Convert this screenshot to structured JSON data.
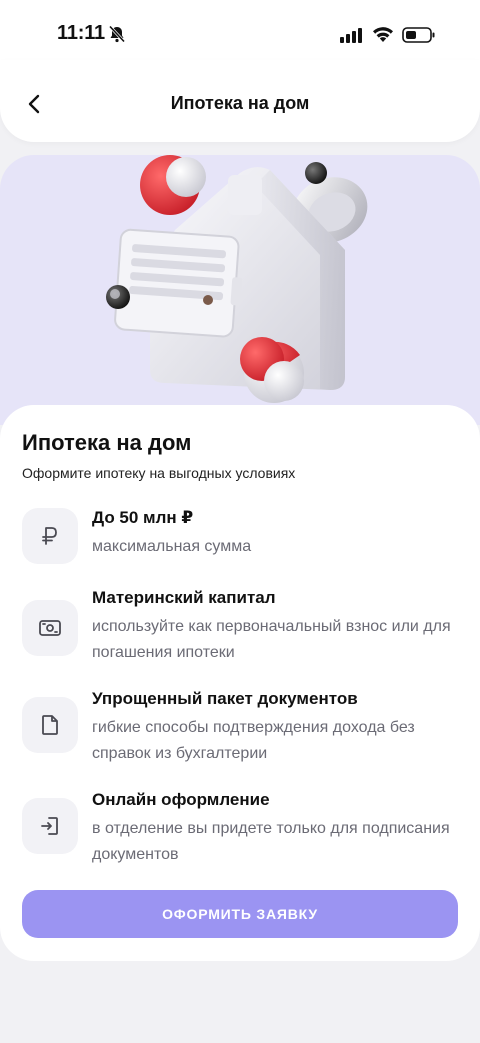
{
  "status_bar": {
    "time": "11:11"
  },
  "header": {
    "title": "Ипотека на дом"
  },
  "main": {
    "title": "Ипотека на дом",
    "subtitle": "Оформите ипотеку на выгодных условиях"
  },
  "features": [
    {
      "icon": "ruble-icon",
      "title": "До 50 млн ₽",
      "description": "максимальная сумма"
    },
    {
      "icon": "cash-icon",
      "title": "Материнский капитал",
      "description": "используйте как первоначальный взнос или для погашения ипотеки"
    },
    {
      "icon": "document-icon",
      "title": "Упрощенный пакет документов",
      "description": "гибкие способы подтверждения дохода без справок из бухгалтерии"
    },
    {
      "icon": "sign-in-icon",
      "title": "Онлайн оформление",
      "description": "в отделение вы придете только для подписания документов"
    }
  ],
  "actions": {
    "apply_label": "ОФОРМИТЬ ЗАЯВКУ"
  },
  "colors": {
    "accent": "#9b94f2",
    "hero_bg": "#e6e4f8",
    "icon_bg": "#f2f2f6",
    "muted_text": "#6b6b75"
  }
}
